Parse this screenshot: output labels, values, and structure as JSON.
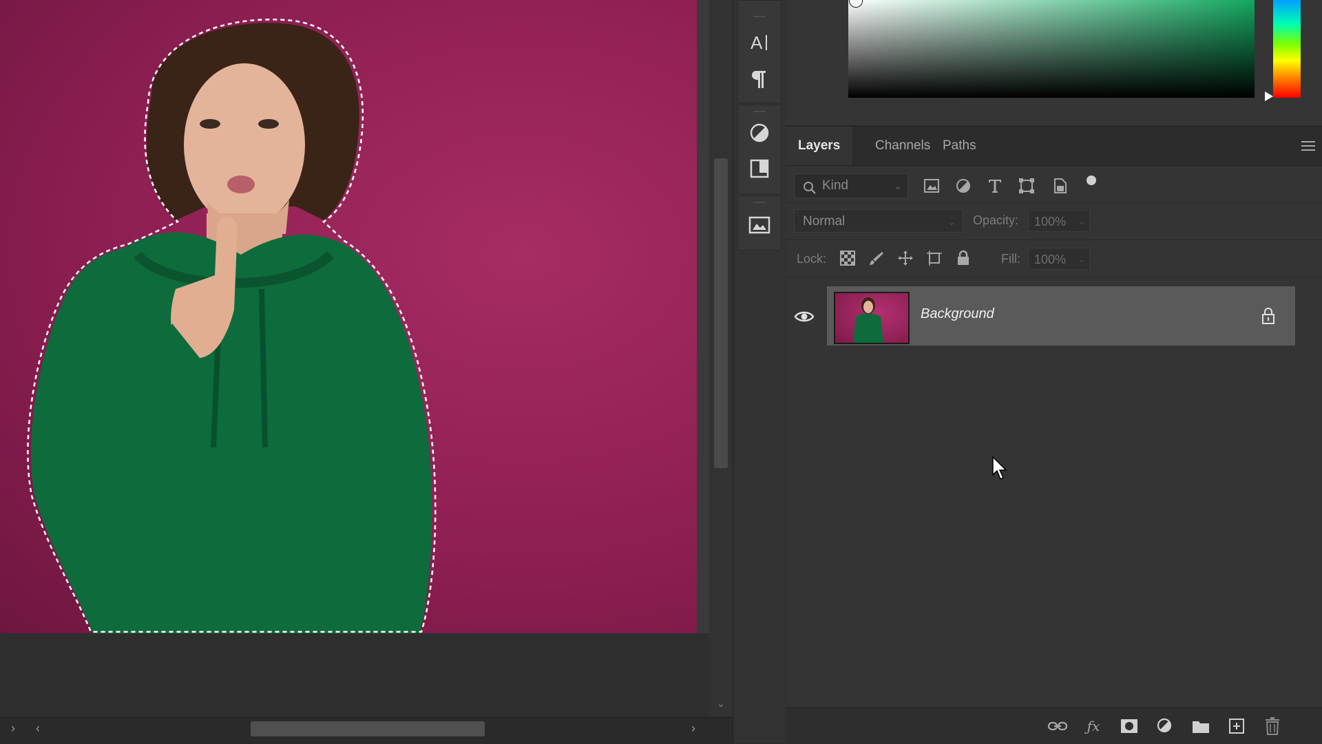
{
  "panel_tabs": [
    {
      "label": "Layers",
      "active": true
    },
    {
      "label": "Channels",
      "active": false
    },
    {
      "label": "Paths",
      "active": false
    }
  ],
  "filter": {
    "kind_label": "Kind",
    "icons": [
      "image-filter-icon",
      "adjustment-filter-icon",
      "type-filter-icon",
      "shape-filter-icon",
      "smart-object-filter-icon",
      "filter-toggle-icon"
    ]
  },
  "blend": {
    "mode": "Normal",
    "opacity_label": "Opacity:",
    "opacity_value": "100%"
  },
  "lock": {
    "label": "Lock:",
    "icons": [
      "lock-transparent-pixels-icon",
      "lock-image-pixels-icon",
      "lock-position-icon",
      "lock-artboard-icon",
      "lock-all-icon"
    ],
    "fill_label": "Fill:",
    "fill_value": "100%"
  },
  "layers": [
    {
      "name": "Background",
      "visible": true,
      "locked": true
    }
  ],
  "footer_icons": [
    "link-layers-icon",
    "layer-style-icon",
    "layer-mask-icon",
    "adjustment-layer-icon",
    "new-group-icon",
    "new-layer-icon",
    "delete-layer-icon"
  ],
  "tool_strip_icons": [
    "character-panel-icon",
    "paragraph-panel-icon",
    "adjustments-panel-icon",
    "properties-panel-icon",
    "libraries-panel-icon"
  ],
  "colors": {
    "canvas_bg": "#8e1f52",
    "hoodie": "#0d6b3c",
    "active_layer": "#5a5a5a",
    "picker_hue": "#13a860"
  }
}
